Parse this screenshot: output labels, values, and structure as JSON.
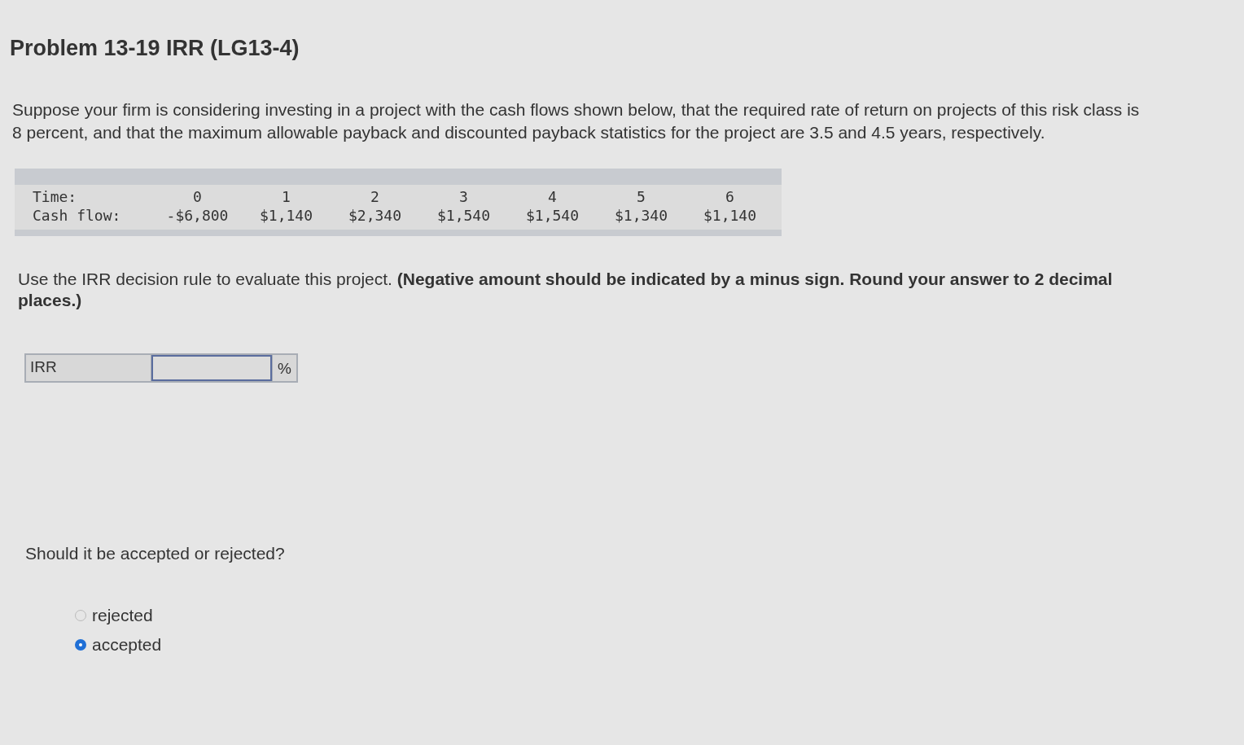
{
  "title": "Problem 13-19 IRR (LG13-4)",
  "intro": "Suppose your firm is considering investing in a project with the cash flows shown below, that the required rate of return on projects of this risk class is 8 percent, and that the maximum allowable payback and discounted payback statistics for the project are 3.5 and 4.5 years, respectively.",
  "table": {
    "row_labels": [
      "Time:",
      "Cash flow:"
    ],
    "columns": [
      {
        "time": "0",
        "cash_flow": "-$6,800"
      },
      {
        "time": "1",
        "cash_flow": "$1,140"
      },
      {
        "time": "2",
        "cash_flow": "$2,340"
      },
      {
        "time": "3",
        "cash_flow": "$1,540"
      },
      {
        "time": "4",
        "cash_flow": "$1,540"
      },
      {
        "time": "5",
        "cash_flow": "$1,340"
      },
      {
        "time": "6",
        "cash_flow": "$1,140"
      }
    ]
  },
  "instruction": "Use the IRR decision rule to evaluate this project. **(Negative amount should be indicated by a minus sign. Round your answer to 2 decimal places.)**",
  "answer": {
    "label": "IRR",
    "unit": "%"
  },
  "question": "Should it be accepted or rejected?",
  "options": [
    {
      "label": "rejected",
      "selected": false
    },
    {
      "label": "accepted",
      "selected": true
    }
  ]
}
